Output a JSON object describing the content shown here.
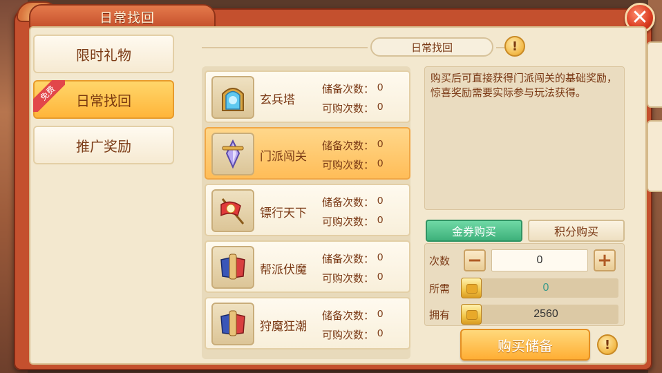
{
  "window": {
    "title": "日常找回",
    "close_icon": "close-icon"
  },
  "menu": {
    "items": [
      {
        "label": "限时礼物",
        "active": false
      },
      {
        "label": "日常找回",
        "active": true,
        "badge": "免费"
      },
      {
        "label": "推广奖励",
        "active": false
      }
    ]
  },
  "section": {
    "title": "日常找回",
    "info_glyph": "!"
  },
  "list": {
    "stat_labels": {
      "reserve": "储备次数：",
      "buyable": "可购次数："
    },
    "items": [
      {
        "name": "玄兵塔",
        "reserve": "0",
        "buyable": "0",
        "icon": "portal-icon",
        "selected": false
      },
      {
        "name": "门派闯关",
        "reserve": "0",
        "buyable": "0",
        "icon": "sword-crystal-icon",
        "selected": true
      },
      {
        "name": "镖行天下",
        "reserve": "0",
        "buyable": "0",
        "icon": "escort-flag-icon",
        "selected": false
      },
      {
        "name": "帮派伏魔",
        "reserve": "0",
        "buyable": "0",
        "icon": "banner-scroll-icon",
        "selected": false
      },
      {
        "name": "狩魔狂潮",
        "reserve": "0",
        "buyable": "0",
        "icon": "banner-scroll-icon",
        "selected": false
      }
    ]
  },
  "detail": {
    "description": "购买后可直接获得门派闯关的基础奖励，惊喜奖励需要实际参与玩法获得。",
    "tabs": {
      "gold_coupon": "金券购买",
      "points": "积分购买"
    },
    "count_label": "次数",
    "count_value": "0",
    "minus": "−",
    "plus": "+",
    "required_label": "所需",
    "required_value": "0",
    "owned_label": "拥有",
    "owned_value": "2560",
    "buy_button": "购买储备",
    "info_glyph": "!"
  },
  "colors": {
    "accent": "#c4502e",
    "selected": "#ffbd58",
    "green": "#3eb17b",
    "required_value": "#3a9a8a"
  }
}
